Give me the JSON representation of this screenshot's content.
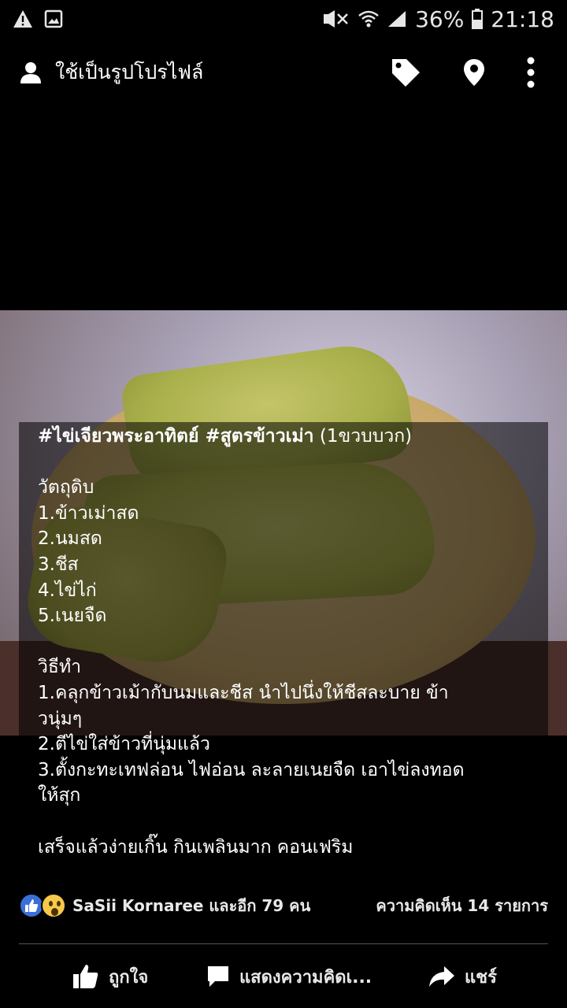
{
  "status_bar": {
    "battery_percent": "36%",
    "time": "21:18",
    "icons": [
      "warning-icon",
      "image-icon",
      "mute-icon",
      "wifi-icon",
      "signal-icon",
      "battery-icon"
    ]
  },
  "top_bar": {
    "profile_label": "ใช้เป็นรูปโปรไฟล์",
    "icons": [
      "person-icon",
      "tag-icon",
      "location-pin-icon",
      "more-vert-icon"
    ]
  },
  "caption": {
    "lines": [
      "#ไข่เจียวพระอาทิตย์ #สูตรข้าวเม่า (1ขวบบวก)",
      "",
      "วัตถุดิบ",
      "1.ข้าวเม่าสด",
      "2.นมสด",
      "3.ชีส",
      "4.ไข่ไก่",
      "5.เนยจืด",
      "",
      "วิธีทำ",
      "1.คลุกข้าวเม้ากับนมและชีส นำไปนึ่งให้ชีสละบาย ข้า",
      "วนุ่มๆ",
      "2.ตีไข่ใส่ข้าวที่นุ่มแล้ว",
      "3.ตั้งกะทะเทฟล่อน ไฟอ่อน ละลายเนยจืด เอาไข่ลงทอด",
      "ให้สุก",
      "",
      "เสร็จแล้วง่ายเกิ๊น กินเพลินมาก คอนเฟริม"
    ],
    "tags": "#ไข่เจียวพระอาทิตย์ #สูตรข้าวเม่า",
    "tags_suffix": " (1ขวบบวก)"
  },
  "reactions": {
    "names": "SaSii Kornaree และอีก 79 คน",
    "comments": "ความคิดเห็น 14 รายการ",
    "icons": [
      "like-reaction-icon",
      "wow-reaction-icon"
    ]
  },
  "actions": {
    "like": "ถูกใจ",
    "comment": "แสดงความคิดเ...",
    "share": "แชร์"
  },
  "colors": {
    "background": "#000000",
    "like_blue": "#3b6fd8",
    "wow_yellow": "#f7c94a"
  }
}
